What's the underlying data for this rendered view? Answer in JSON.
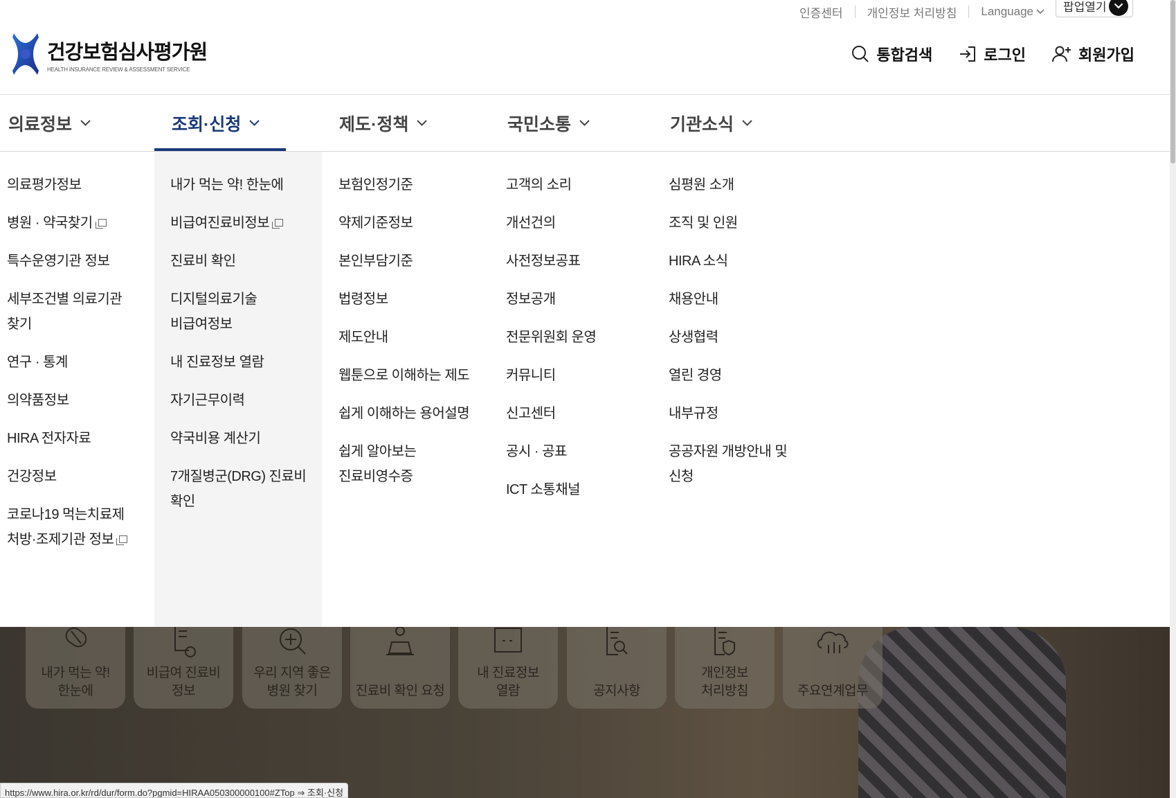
{
  "util": {
    "cert": "인증센터",
    "privacy": "개인정보 처리방침",
    "language": "Language",
    "popup": "팝업열기"
  },
  "logo": {
    "ko": "건강보험심사평가원",
    "en": "HEALTH INSURANCE REVIEW & ASSESSMENT SERVICE"
  },
  "header": {
    "search": "통합검색",
    "login": "로그인",
    "join": "회원가입"
  },
  "gnb": [
    "의료정보",
    "조회·신청",
    "제도·정책",
    "국민소통",
    "기관소식"
  ],
  "mega": {
    "col1": [
      "의료평가정보",
      "병원 · 약국찾기",
      "특수운영기관 정보",
      "세부조건별 의료기관",
      "찾기",
      "연구 · 통계",
      "의약품정보",
      "HIRA 전자자료",
      "건강정보",
      "코로나19 먹는치료제",
      "처방·조제기관 정보"
    ],
    "col2": [
      "내가 먹는 약! 한눈에",
      "비급여진료비정보",
      "진료비 확인",
      "디지털의료기술",
      "비급여정보",
      "내 진료정보 열람",
      "자기근무이력",
      "약국비용 계산기",
      "7개질병군(DRG) 진료비",
      "확인"
    ],
    "col3": [
      "보험인정기준",
      "약제기준정보",
      "본인부담기준",
      "법령정보",
      "제도안내",
      "웹툰으로 이해하는 제도",
      "쉽게 이해하는 용어설명",
      "쉽게 알아보는",
      "진료비영수증"
    ],
    "col4": [
      "고객의 소리",
      "개선건의",
      "사전정보공표",
      "정보공개",
      "전문위원회 운영",
      "커뮤니티",
      "신고센터",
      "공시 · 공표",
      "ICT 소통채널"
    ],
    "col5": [
      "심평원 소개",
      "조직 및 인원",
      "HIRA 소식",
      "채용안내",
      "상생협력",
      "열린 경영",
      "내부규정",
      "공공자원 개방안내 및",
      "신청"
    ]
  },
  "quick": [
    {
      "line1": "내가 먹는 약!",
      "line2": "한눈에"
    },
    {
      "line1": "비급여 진료비",
      "line2": "정보"
    },
    {
      "line1": "우리 지역 좋은",
      "line2": "병원 찾기"
    },
    {
      "line1": "진료비 확인 요청",
      "line2": ""
    },
    {
      "line1": "내 진료정보",
      "line2": "열람"
    },
    {
      "line1": "공지사항",
      "line2": ""
    },
    {
      "line1": "개인정보",
      "line2": "처리방침"
    },
    {
      "line1": "주요연계업무",
      "line2": ""
    }
  ],
  "status_url": "https://www.hira.or.kr/rd/dur/form.do?pgmid=HIRAA050300000100#ZTop ⇒ 조회·신청"
}
